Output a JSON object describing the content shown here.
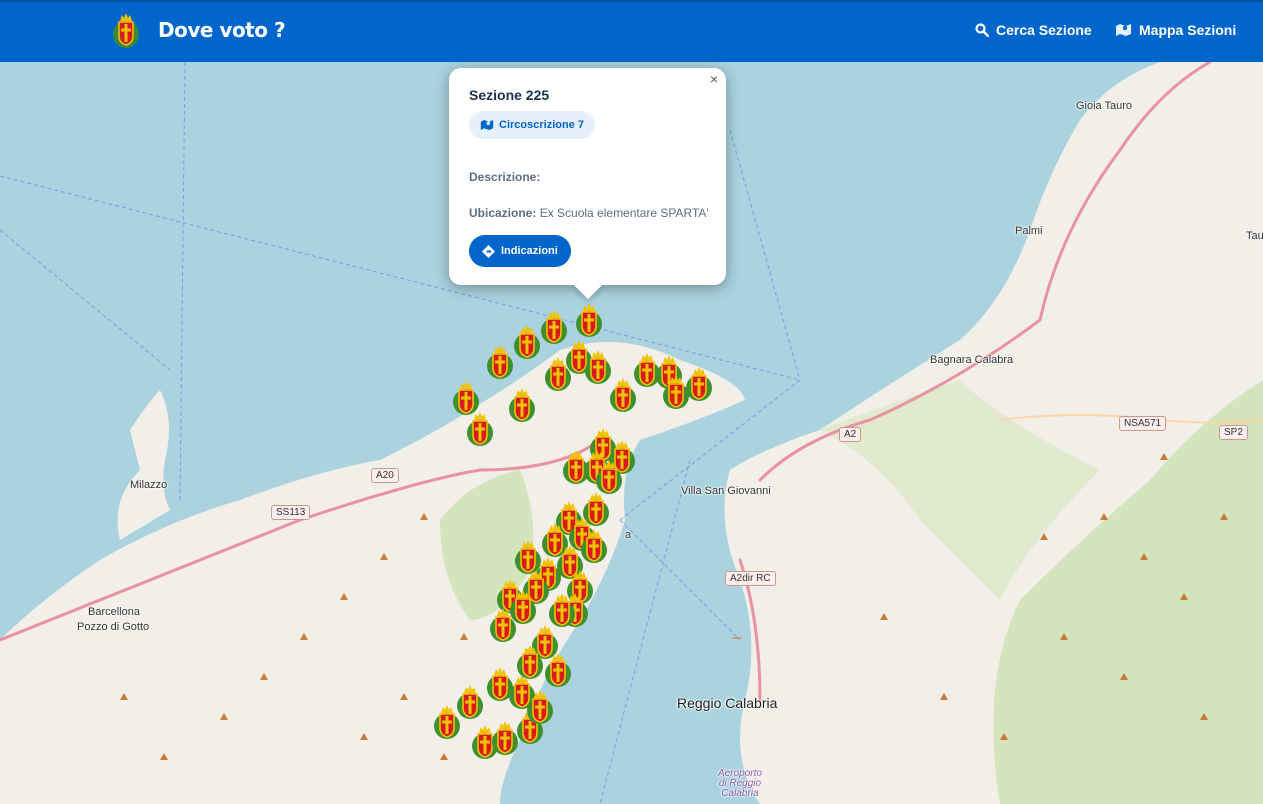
{
  "header": {
    "title": "Dove voto ?",
    "nav": {
      "search_label": "Cerca Sezione",
      "map_label": "Mappa Sezioni"
    }
  },
  "popup": {
    "title": "Sezione 225",
    "badge": "Circoscrizione 7",
    "close": "×",
    "desc_label": "Descrizione:",
    "ubic_label": "Ubicazione:",
    "ubic_value": "Ex Scuola elementare SPARTA'",
    "button": "Indicazioni"
  },
  "map": {
    "places": {
      "gioia_tauro": "Gioia Tauro",
      "palmi": "Palmi",
      "tau": "Tau",
      "bagnara": "Bagnara Calabra",
      "milazzo": "Milazzo",
      "villa": "Villa San Giovanni",
      "barcellona1": "Barcellona",
      "barcellona2": "Pozzo di Gotto",
      "reggio": "Reggio Calabria",
      "messina_frag": "a",
      "airport1": "Aeroporto",
      "airport2": "di Reggio",
      "airport3": "Calabria"
    },
    "shields": {
      "a20": "A20",
      "ss113": "SS113",
      "a2": "A2",
      "nsa571": "NSA571",
      "sp2": "SP2",
      "a2dir1": "A2dir RC",
      "a2dir2": "A2dirRC"
    }
  },
  "colors": {
    "primary": "#0066cc",
    "sea": "#aad3df",
    "land": "#f2efe9",
    "forest": "#c8dfaa"
  }
}
